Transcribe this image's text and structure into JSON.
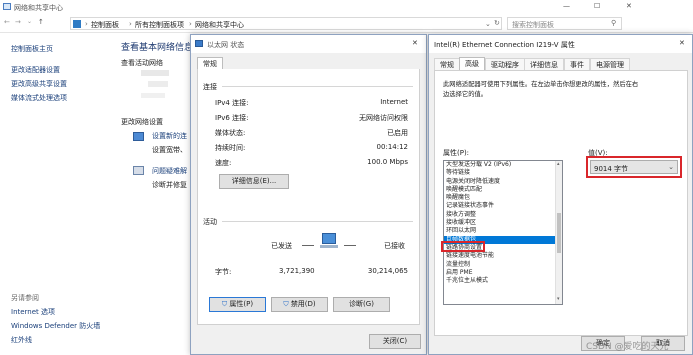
{
  "nsc": {
    "title": "网络和共享中心",
    "title_controls": [
      "—",
      "☐",
      "✕"
    ],
    "breadcrumb": [
      "控制面板",
      "所有控制面板项",
      "网络和共享中心"
    ],
    "search_placeholder": "搜索控制面板",
    "sidebar": {
      "home": "控制面板主页",
      "links": [
        "更改适配器设置",
        "更改高级共享设置",
        "媒体流式处理选项"
      ],
      "see_also_title": "另请参阅",
      "see_also": [
        "Internet 选项",
        "Windows Defender 防火墙",
        "红外线"
      ]
    },
    "main": {
      "heading": "查看基本网络信息",
      "active_networks": "查看活动网络",
      "change_settings": "更改网络设置",
      "items": [
        {
          "title": "设置新的连",
          "desc": "设置宽带、"
        },
        {
          "title": "问题疑难解",
          "desc": "诊断并修复"
        }
      ]
    }
  },
  "eth": {
    "title": "以太网 状态",
    "close": "✕",
    "tab": "常规",
    "connection_title": "连接",
    "rows": [
      {
        "label": "IPv4 连接:",
        "value": "Internet"
      },
      {
        "label": "IPv6 连接:",
        "value": "无网络访问权限"
      },
      {
        "label": "媒体状态:",
        "value": "已启用"
      },
      {
        "label": "持续时间:",
        "value": "00:14:12"
      },
      {
        "label": "速度:",
        "value": "100.0 Mbps"
      }
    ],
    "details_button": "详细信息(E)...",
    "activity_title": "活动",
    "sent": "已发送",
    "received": "已接收",
    "bytes_label": "字节:",
    "bytes_sent": "3,721,390",
    "bytes_received": "30,214,065",
    "buttons": {
      "properties": "属性(P)",
      "disable": "禁用(D)",
      "diagnose": "诊断(G)"
    },
    "close_button": "关闭(C)"
  },
  "adp": {
    "title": "Intel(R) Ethernet Connection I219-V 属性",
    "close": "✕",
    "tabs": [
      "常规",
      "高级",
      "驱动程序",
      "详细信息",
      "事件",
      "电源管理"
    ],
    "active_tab": 1,
    "description": [
      "此网络适配器可使用下列属性。在左边单击你想更改的属性，然后在右",
      "边选择它的值。"
    ],
    "property_label": "属性(P):",
    "value_label": "值(V):",
    "properties": [
      "大型发送分载 V2 (IPv6)",
      "等待链接",
      "电源关闭时降低速度",
      "唤醒模式匹配",
      "唤醒魔包",
      "记录链接状态事件",
      "接收方调整",
      "接收缓冲区",
      "环回以太网",
      "巨帧数据包",
      "链路协商设置",
      "链接速度电池节能",
      "流量控制",
      "启用 PME",
      "千兆位主从模式"
    ],
    "selected_index": 9,
    "value": "9014 字节",
    "ok": "确定",
    "cancel": "取消"
  },
  "watermark": "CSDN @爱吃的天光",
  "colors": {
    "highlight": "#0078d7",
    "link": "#1a3f7a",
    "redbox": "#d9262b"
  }
}
